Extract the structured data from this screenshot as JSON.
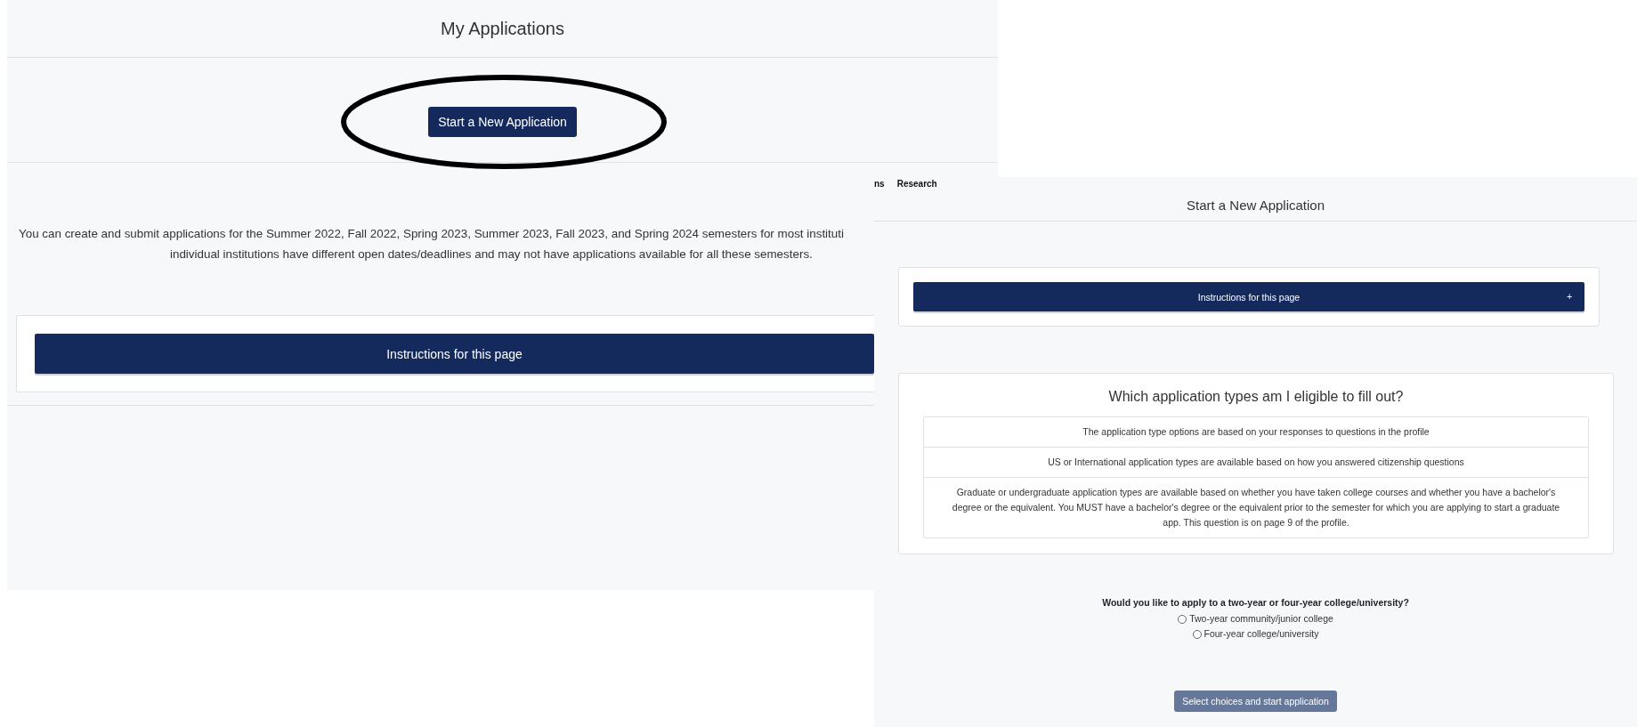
{
  "my_applications": {
    "title": "My Applications",
    "start_button": "Start a New Application",
    "intro_lines": [
      "You can create and submit applications for the Summer 2022, Fall 2022, Spring 2023, Summer 2023, Fall 2023, and Spring 2024 semesters for most instituti",
      "individual institutions have different open dates/deadlines and may not have applications available for all these semesters."
    ],
    "instructions": {
      "label": "Instructions for this page"
    }
  },
  "new_application": {
    "nav": [
      "ns",
      "Research"
    ],
    "title": "Start a New Application",
    "instructions": {
      "label": "Instructions for this page",
      "toggle": "+",
      "expanded": false
    },
    "eligibility": {
      "heading": "Which application types am I eligible to fill out?",
      "rows": [
        "The application type options are based on your responses to questions in the profile",
        "US or International application types are available based on how you answered citizenship questions",
        "Graduate or undergraduate application types are available based on whether you have taken college courses and whether you have a bachelor's degree or the equivalent. You MUST have a bachelor's degree or the equivalent prior to the semester for which you are applying to start a graduate app. This question is on page 9 of the profile."
      ]
    },
    "question": "Would you like to apply to a two-year or four-year college/university?",
    "options": [
      {
        "label": "Two-year community/junior college",
        "selected": false
      },
      {
        "label": "Four-year college/university",
        "selected": false
      }
    ],
    "submit": {
      "label": "Select choices and start application",
      "disabled": true
    }
  }
}
